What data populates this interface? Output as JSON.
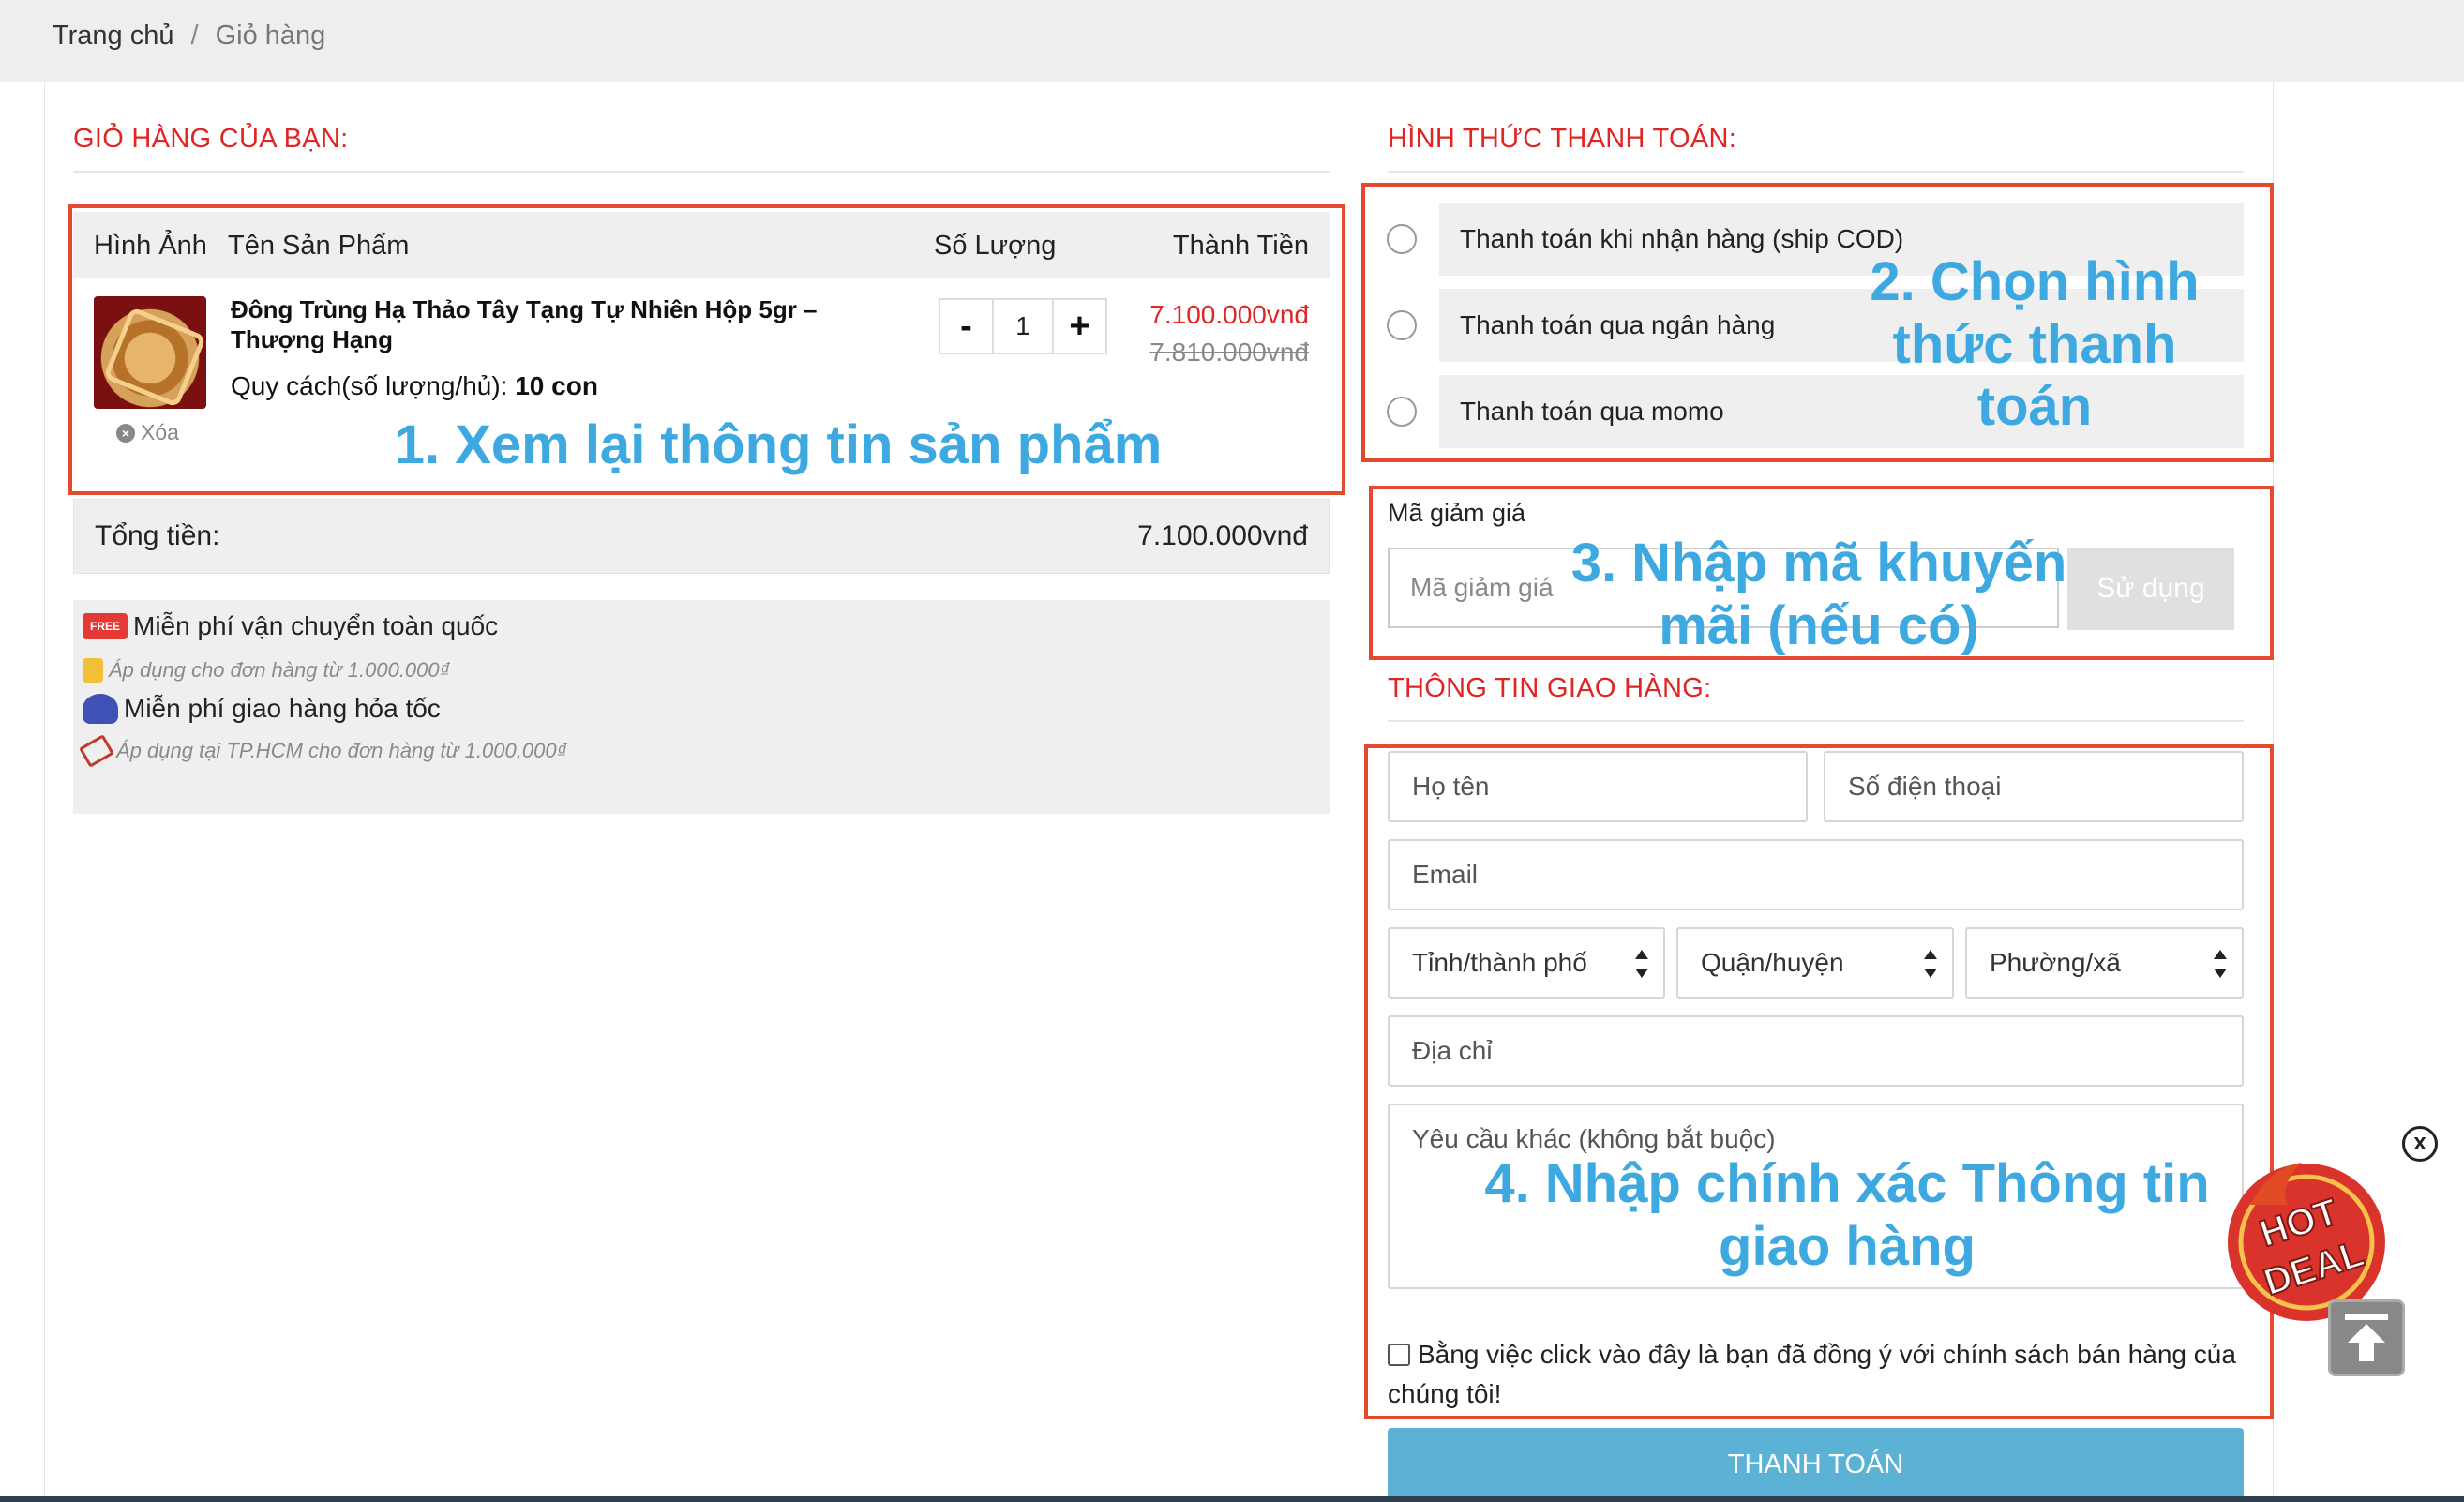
{
  "breadcrumb": {
    "home": "Trang chủ",
    "separator": "/",
    "current": "Giỏ hàng"
  },
  "cart": {
    "title": "GIỎ HÀNG CỦA BẠN:",
    "columns": [
      "Hình Ảnh",
      "Tên Sản Phẩm",
      "Số Lượng",
      "Thành Tiền"
    ],
    "item": {
      "name": "Đông Trùng Hạ Thảo Tây Tạng Tự Nhiên Hộp 5gr – Thượng Hạng",
      "spec_label": "Quy cách(số lượng/hủ):",
      "spec_value": "10 con",
      "delete_label": "Xóa",
      "quantity": "1",
      "minus": "-",
      "plus": "+",
      "price": "7.100.000vnđ",
      "old_price": "7.810.000vnđ"
    },
    "total_label": "Tổng tiền:",
    "total_value": "7.100.000vnđ"
  },
  "promos": {
    "free_badge": "FREE",
    "free_ship": "Miễn phí vận chuyển toàn quốc",
    "free_ship_note": "Áp dụng cho đơn hàng từ 1.000.000₫",
    "express": "Miễn phí giao hàng hỏa tốc",
    "express_note": "Áp dụng tại TP.HCM cho đơn hàng từ 1.000.000₫"
  },
  "payment": {
    "title": "HÌNH THỨC THANH TOÁN:",
    "options": [
      "Thanh toán khi nhận hàng (ship COD)",
      "Thanh toán qua ngân hàng",
      "Thanh toán qua momo"
    ]
  },
  "coupon": {
    "label": "Mã giảm giá",
    "placeholder": "Mã giảm giá",
    "button": "Sử dụng"
  },
  "shipping": {
    "title": "THÔNG TIN GIAO HÀNG:",
    "name_placeholder": "Họ tên",
    "phone_placeholder": "Số điện thoại",
    "email_placeholder": "Email",
    "province": "Tỉnh/thành phố",
    "district": "Quận/huyện",
    "ward": "Phường/xã",
    "address_placeholder": "Địa chỉ",
    "note_placeholder": "Yêu cầu khác (không bắt buộc)",
    "agree_text": "Bằng việc click vào đây là bạn đã đồng ý với chính sách bán hàng của chúng tôi!",
    "submit": "THANH TOÁN"
  },
  "guide": {
    "step1": "1. Xem lại thông tin sản phẩm",
    "step2": "2. Chọn hình thức thanh toán",
    "step3": "3. Nhập mã khuyến mãi (nếu có)",
    "step4": "4. Nhập chính xác Thông tin giao hàng"
  },
  "widgets": {
    "close": "x",
    "hotdeal_line1": "HOT",
    "hotdeal_line2": "DEAL"
  },
  "colors": {
    "accent_red": "#e02525",
    "annotation_red": "#e34a2e",
    "annotation_blue": "#3ea8e0",
    "pay_button": "#5bb2d4"
  }
}
